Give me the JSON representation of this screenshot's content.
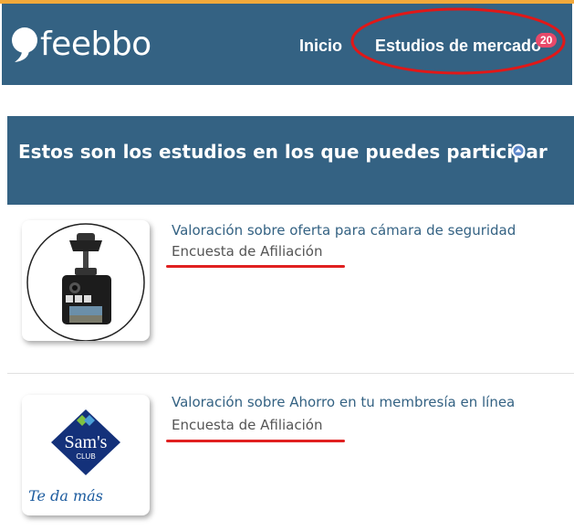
{
  "header": {
    "logo_text": "feebbo",
    "nav": [
      {
        "label": "Inicio"
      },
      {
        "label": "Estudios de mercado",
        "badge": "20"
      }
    ],
    "colors": {
      "bar": "#346283",
      "accent_top": "#f2a93b",
      "badge": "#e8496a"
    }
  },
  "banner": {
    "title": "Estos son los estudios en los que puedes participar",
    "icon": "circle-arrow-up-icon"
  },
  "studies": [
    {
      "title": "Valoración sobre oferta para cámara de seguridad",
      "type": "Encuesta de Afiliación",
      "image": "dashcam-camera-image"
    },
    {
      "title": "Valoración sobre Ahorro en tu membresía en línea",
      "type": "Encuesta de Afiliación",
      "image": "sams-club-logo-image",
      "image_text": {
        "brand": "Sam's",
        "sub": "CLUB",
        "tagline": "Te da más"
      }
    }
  ]
}
